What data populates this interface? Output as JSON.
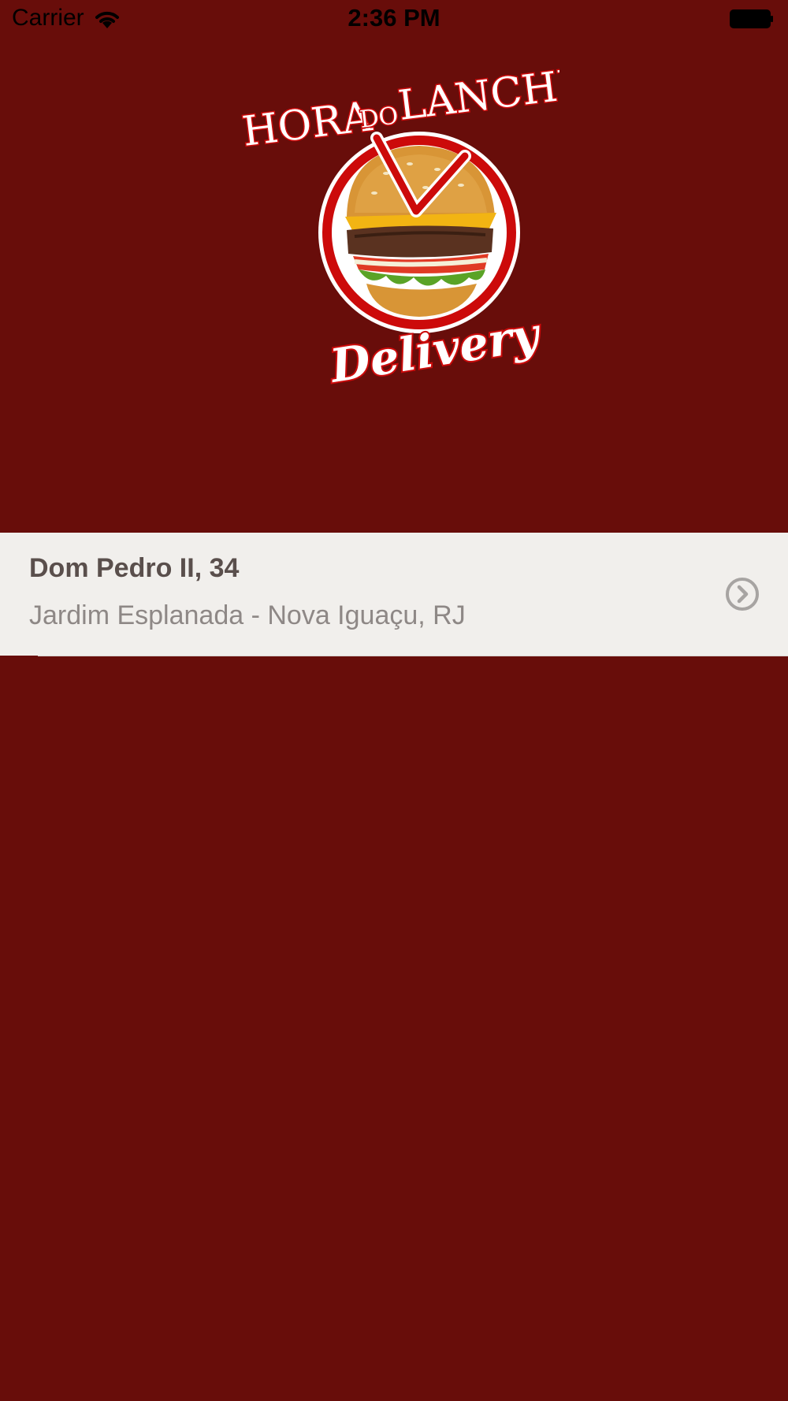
{
  "status_bar": {
    "carrier": "Carrier",
    "time": "2:36 PM",
    "wifi_icon": "wifi-icon",
    "battery_icon": "battery-full-icon"
  },
  "logo": {
    "line1_a": "HORA",
    "line1_b": "DO",
    "line1_c": "LANCHE",
    "line2": "Delivery",
    "image": "burger-clock-logo",
    "accent_color": "#cc0a0a"
  },
  "address_list": {
    "items": [
      {
        "street": "Dom Pedro II, 34",
        "region": "Jardim Esplanada - Nova Iguaçu, RJ",
        "action_icon": "chevron-right-circle-icon"
      }
    ]
  },
  "colors": {
    "background": "#680d0a",
    "row_background": "#f1efec",
    "street_text": "#5a4f4c",
    "region_text": "#8e8886"
  }
}
